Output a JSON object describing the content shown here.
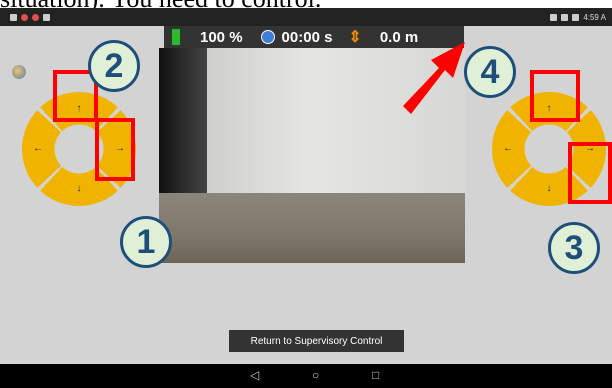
{
  "caption_fragment": "situation). You need to control.",
  "statusbar": {
    "time": "4:59 A"
  },
  "hud": {
    "battery": "100 %",
    "elapsed": "00:00 s",
    "distance": "0.0 m"
  },
  "left_dpad": {
    "up": "↑",
    "down": "↓",
    "left": "←",
    "right": "→"
  },
  "right_dpad": {
    "up": "↑",
    "down": "↓",
    "left": "←",
    "right": "→"
  },
  "callouts": {
    "c1": "1",
    "c2": "2",
    "c3": "3",
    "c4": "4"
  },
  "return_button": {
    "label": "Return to Supervisory Control"
  },
  "navbar": {
    "back": "◁",
    "home": "○",
    "recents": "□"
  },
  "colors": {
    "callout_border": "#1e4e7a",
    "callout_fill": "#dff0d6",
    "highlight": "#ff0000",
    "dpad": "#f0b400",
    "battery": "#2eb82e"
  }
}
